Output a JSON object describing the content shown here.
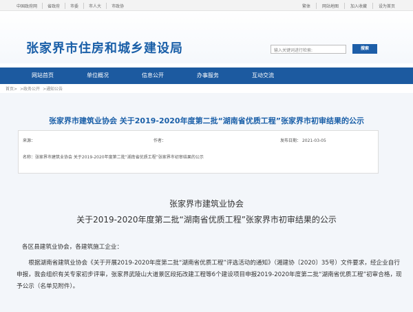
{
  "topbar": {
    "left_links": [
      "中国政府网",
      "省政府",
      "市委",
      "市人大",
      "市政协"
    ],
    "right_links": [
      "繁体",
      "网站地图",
      "加入收藏",
      "设为首页"
    ]
  },
  "header": {
    "site_title": "张家界市住房和城乡建设局",
    "search_placeholder": "输入关键词进行检索:",
    "search_button": "搜索"
  },
  "nav": {
    "items": [
      "网站首页",
      "单位概况",
      "信息公开",
      "办事服务",
      "互动交流"
    ]
  },
  "breadcrumb": [
    "首页>",
    ">政务公开",
    ">通知公告"
  ],
  "article": {
    "title": "张家界市建筑业协会 关于2019-2020年度第二批“湖南省优质工程”张家界市初审结果的公示",
    "meta": {
      "source_label": "来源：",
      "author_label": "作者：",
      "date_label": "发布日期：",
      "date_value": "2021-03-05",
      "name_label": "名称：",
      "name_value": "张家界市建筑业协会 关于2019-2020年度第二批“湖南省优质工程”张家界市初审结果的公示"
    },
    "body_title_line1": "张家界市建筑业协会",
    "body_title_line2": "关于2019-2020年度第二批“湖南省优质工程”张家界市初审结果的公示",
    "salutation": "各区县建筑业协会，各建筑施工企业：",
    "paragraph": "　　根据湖南省建筑业协会《关于开展2019-2020年度第二批“湖南省优质工程”评选活动的通知》（湘建协〔2020〕35号）文件要求，经企业自行申报，我会组织有关专家初步评审，张家界武陵山大道景区段拓改建工程等6个建设项目申报2019-2020年度第二批“湖南省优质工程”初审合格，现予公示（名单见附件）。"
  },
  "colors": {
    "brand_blue": "#1c5aa0",
    "title_blue": "#1a5fa8"
  }
}
